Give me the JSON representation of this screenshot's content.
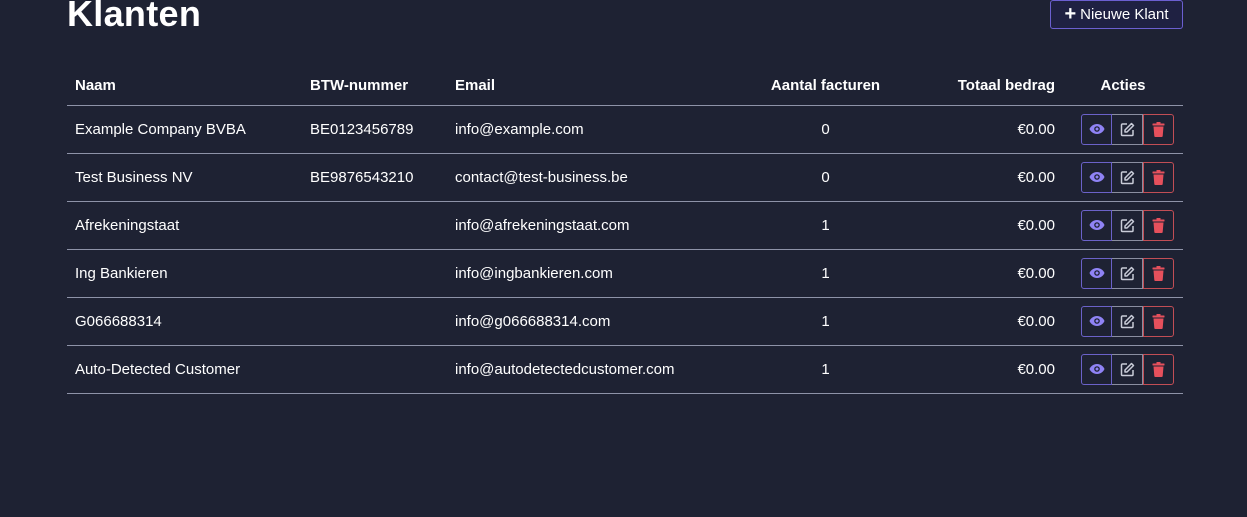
{
  "page": {
    "title": "Klanten",
    "new_button_label": "Nieuwe Klant",
    "new_button_icon": "plus-icon"
  },
  "table": {
    "headers": {
      "name": "Naam",
      "vat": "BTW-nummer",
      "email": "Email",
      "invoice_count": "Aantal facturen",
      "total": "Totaal bedrag",
      "actions": "Acties"
    },
    "rows": [
      {
        "name": "Example Company BVBA",
        "vat": "BE0123456789",
        "email": "info@example.com",
        "invoice_count": "0",
        "total": "€0.00"
      },
      {
        "name": "Test Business NV",
        "vat": "BE9876543210",
        "email": "contact@test-business.be",
        "invoice_count": "0",
        "total": "€0.00"
      },
      {
        "name": "Afrekeningstaat",
        "vat": "",
        "email": "info@afrekeningstaat.com",
        "invoice_count": "1",
        "total": "€0.00"
      },
      {
        "name": "Ing Bankieren",
        "vat": "",
        "email": "info@ingbankieren.com",
        "invoice_count": "1",
        "total": "€0.00"
      },
      {
        "name": "G066688314",
        "vat": "",
        "email": "info@g066688314.com",
        "invoice_count": "1",
        "total": "€0.00"
      },
      {
        "name": "Auto-Detected Customer",
        "vat": "",
        "email": "info@autodetectedcustomer.com",
        "invoice_count": "1",
        "total": "€0.00"
      }
    ],
    "row_actions": {
      "view_icon": "eye-icon",
      "edit_icon": "edit-icon",
      "delete_icon": "trash-icon"
    }
  },
  "colors": {
    "background": "#1e2233",
    "accent": "#7c6ff0",
    "danger": "#e05560",
    "edit": "#c9ccd8"
  }
}
